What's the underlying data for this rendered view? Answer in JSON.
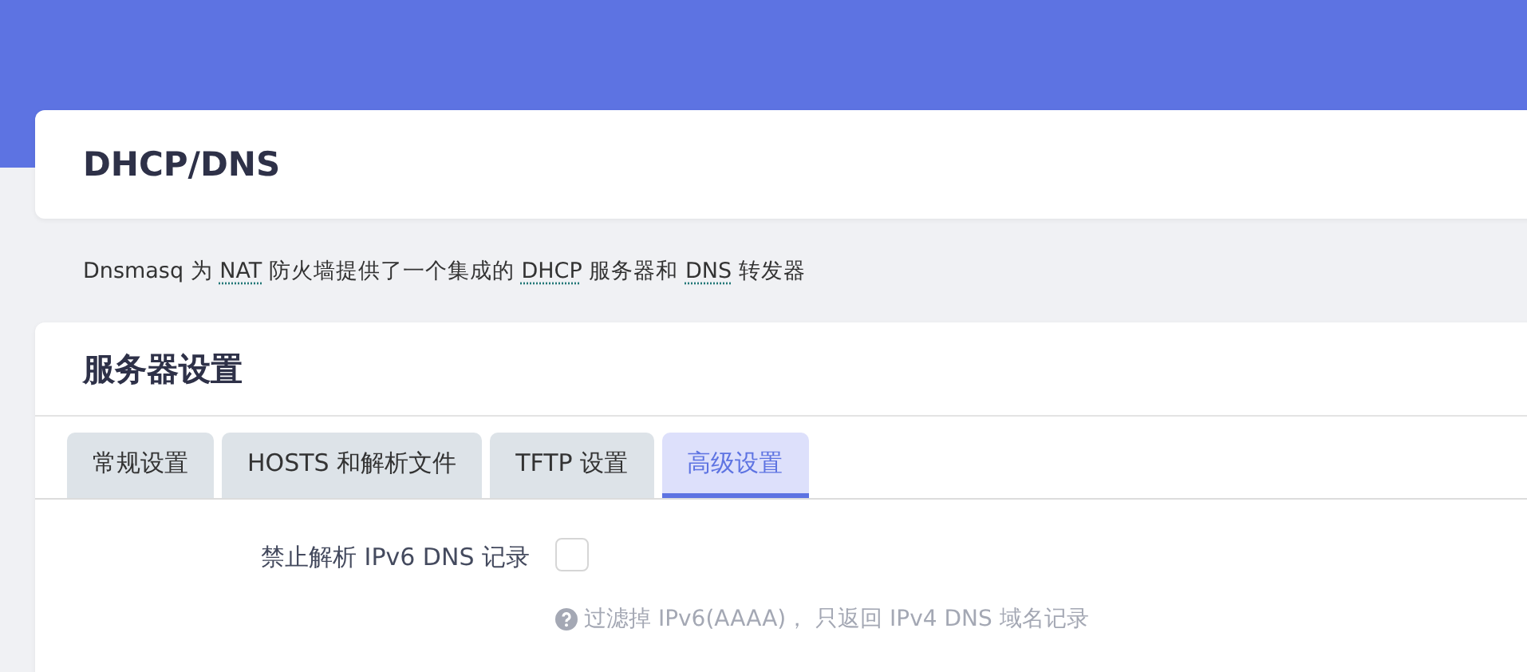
{
  "page_title": "DHCP/DNS",
  "description": [
    {
      "kind": "text",
      "text": "Dnsmasq 为 "
    },
    {
      "kind": "abbr",
      "text": "NAT"
    },
    {
      "kind": "text",
      "text": " 防火墙提供了一个集成的 "
    },
    {
      "kind": "abbr",
      "text": "DHCP"
    },
    {
      "kind": "text",
      "text": " 服务器和 "
    },
    {
      "kind": "abbr",
      "text": "DNS"
    },
    {
      "kind": "text",
      "text": " 转发器"
    }
  ],
  "section": {
    "title": "服务器设置",
    "tabs": [
      {
        "label": "常规设置",
        "selected": false
      },
      {
        "label": "HOSTS 和解析文件",
        "selected": false
      },
      {
        "label": "TFTP 设置",
        "selected": false
      },
      {
        "label": "高级设置",
        "selected": true
      }
    ],
    "fields": [
      {
        "label": "禁止解析 IPv6 DNS 记录",
        "checked": false,
        "help": "过滤掉 IPv6(AAAA)， 只返回 IPv4 DNS 域名记录"
      }
    ]
  }
}
